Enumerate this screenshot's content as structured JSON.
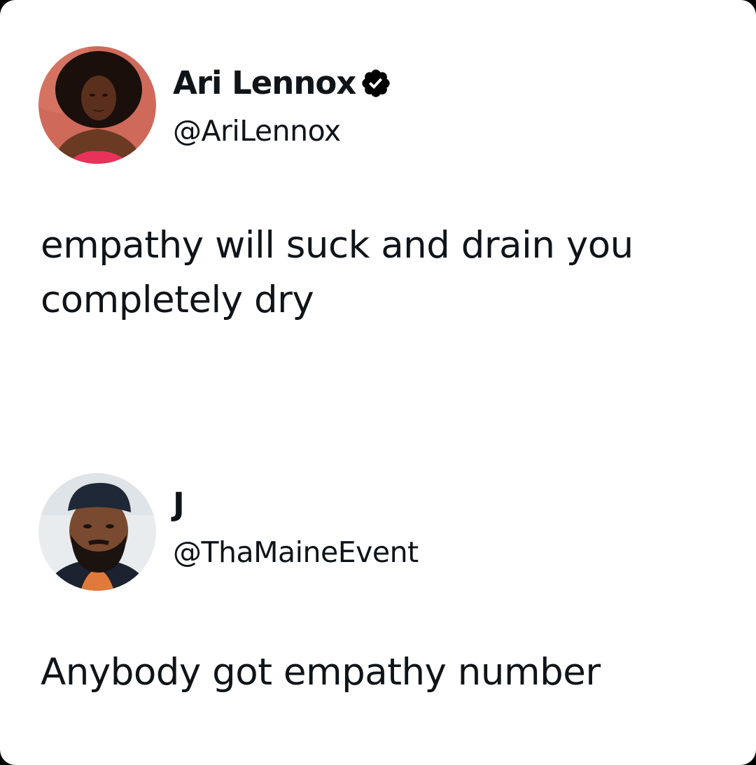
{
  "tweets": [
    {
      "author": {
        "name": "Ari Lennox",
        "handle": "@AriLennox",
        "verified": true,
        "avatar_icon": "woman-portrait-avatar"
      },
      "text": "empathy will suck and drain you completely dry"
    },
    {
      "author": {
        "name": "J",
        "handle": "@ThaMaineEvent",
        "verified": false,
        "avatar_icon": "man-portrait-avatar"
      },
      "text": "Anybody got empathy number"
    }
  ],
  "colors": {
    "text": "#0f1419",
    "verified_badge": "#000000",
    "background": "#ffffff"
  }
}
